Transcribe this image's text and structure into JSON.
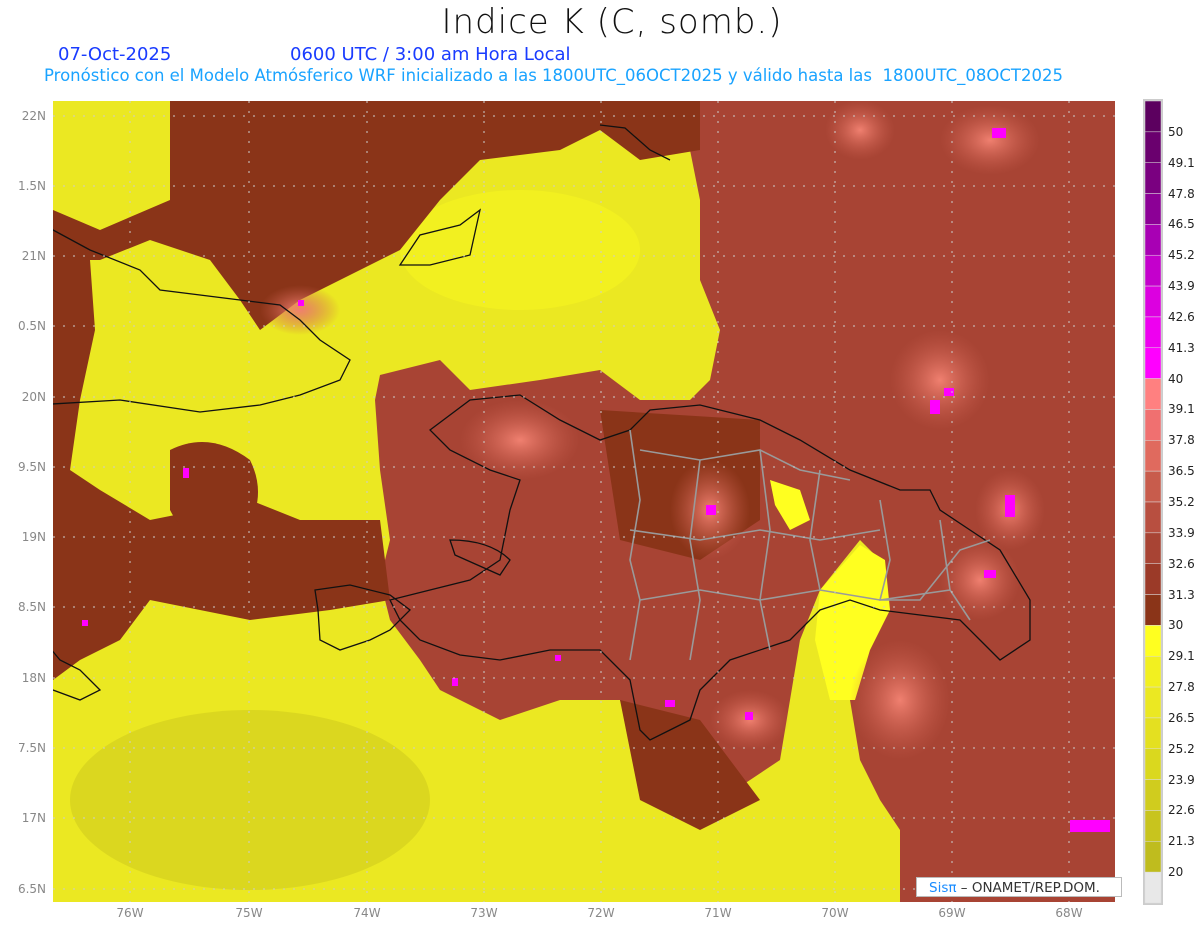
{
  "header": {
    "title": "Indice K (C, somb.)",
    "date": "07-Oct-2025",
    "time": "0600 UTC / 3:00 am Hora Local",
    "description": "Pronóstico con el Modelo Atmósferico WRF inicializado a las 1800UTC_06OCT2025 y válido hasta las  1800UTC_08OCT2025"
  },
  "axes": {
    "lat_labels": [
      "22N",
      "1.5N",
      "21N",
      "0.5N",
      "20N",
      "9.5N",
      "19N",
      "8.5N",
      "18N",
      "7.5N",
      "17N",
      "6.5N"
    ],
    "lon_labels": [
      "76W",
      "75W",
      "74W",
      "73W",
      "72W",
      "71W",
      "70W",
      "69W",
      "68W"
    ]
  },
  "legend": {
    "labels": [
      "50",
      "49.1",
      "47.8",
      "46.5",
      "45.2",
      "43.9",
      "42.6",
      "41.3",
      "40",
      "39.1",
      "37.8",
      "36.5",
      "35.2",
      "33.9",
      "32.6",
      "31.3",
      "30",
      "29.1",
      "27.8",
      "26.5",
      "25.2",
      "23.9",
      "22.6",
      "21.3",
      "20"
    ],
    "colors": [
      "#5c005f",
      "#6a006e",
      "#7a0080",
      "#8c0096",
      "#a800b4",
      "#c400cc",
      "#dc00e0",
      "#ee00f0",
      "#ff00ff",
      "#ff8080",
      "#f07070",
      "#e06a5e",
      "#c85c4c",
      "#b84f40",
      "#a84434",
      "#9b3a28",
      "#8a3418",
      "#ffff20",
      "#f2f020",
      "#ebe822",
      "#e4e020",
      "#dad81e",
      "#d0cc1e",
      "#c8c41e",
      "#bfbc1e",
      "#e8e8e8"
    ]
  },
  "credit": {
    "logo": "Sisπ",
    "text": " – ONAMET/REP.DOM."
  }
}
